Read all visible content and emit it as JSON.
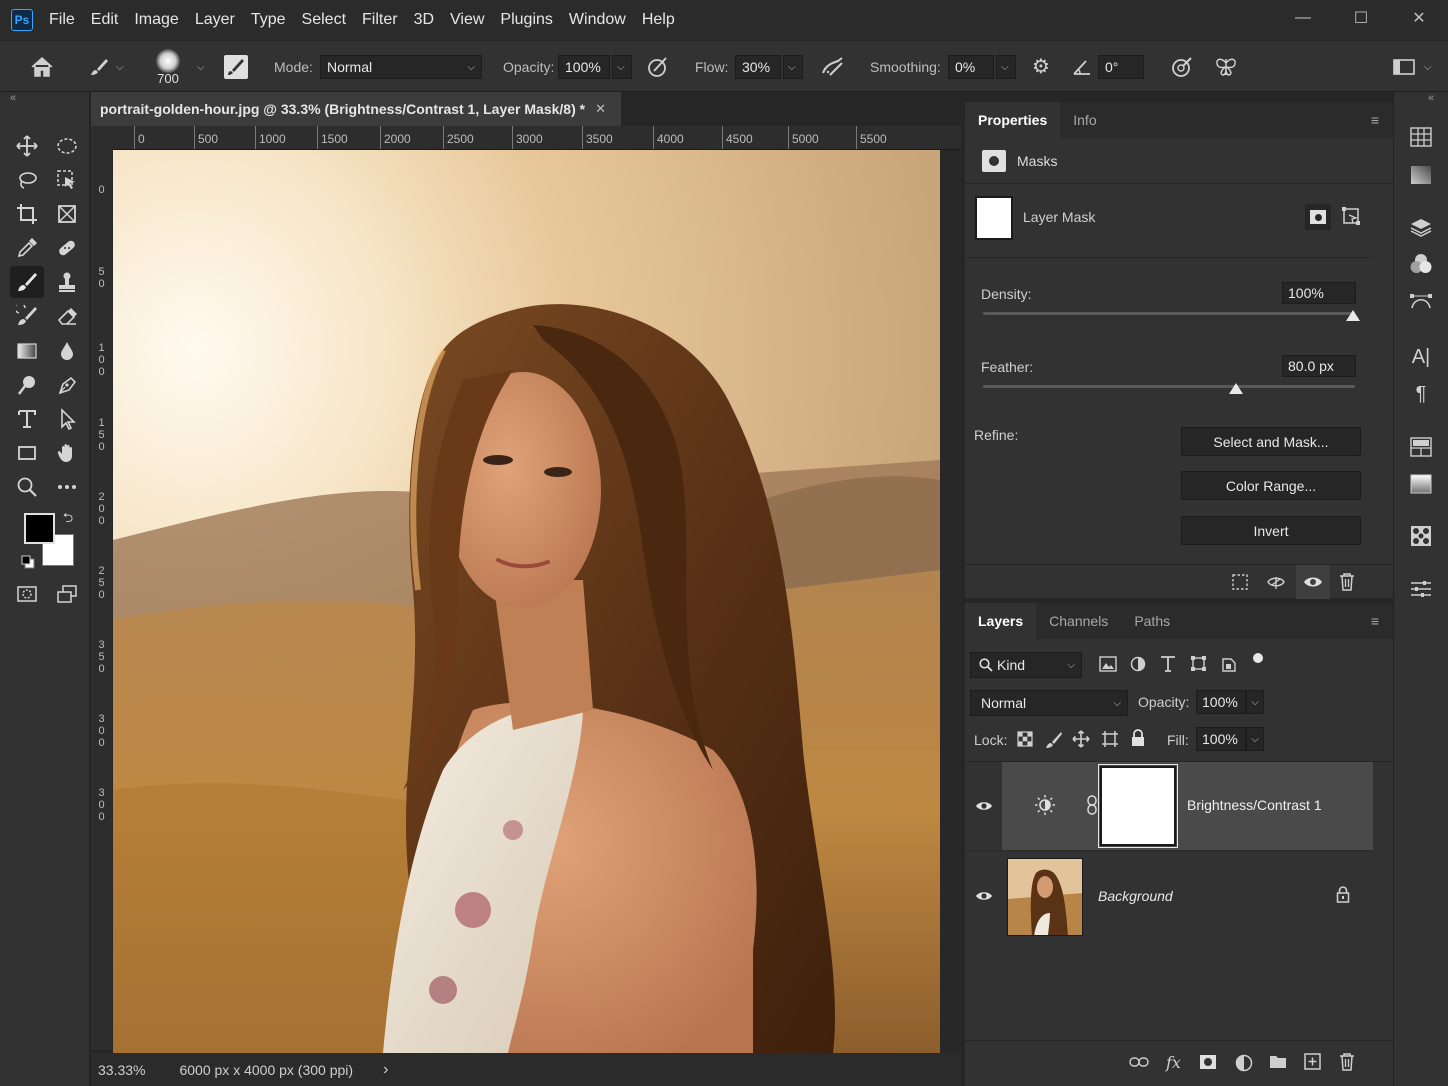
{
  "menu": [
    "File",
    "Edit",
    "Image",
    "Layer",
    "Type",
    "Select",
    "Filter",
    "3D",
    "View",
    "Plugins",
    "Window",
    "Help"
  ],
  "app_logo": "Ps",
  "window_controls": {
    "minimize": "—",
    "maximize": "☐",
    "close": "✕"
  },
  "options": {
    "brush_size": "700",
    "mode_label": "Mode:",
    "mode_value": "Normal",
    "opacity_label": "Opacity:",
    "opacity_value": "100%",
    "flow_label": "Flow:",
    "flow_value": "30%",
    "smoothing_label": "Smoothing:",
    "smoothing_value": "0%",
    "angle_value": "0°"
  },
  "document": {
    "tab_title": "portrait-golden-hour.jpg @ 33.3% (Brightness/Contrast 1, Layer Mask/8) *",
    "tab_close": "✕",
    "ruler_h": [
      "0",
      "500",
      "1000",
      "1500",
      "2000",
      "2500",
      "3000",
      "3500",
      "4000",
      "4500",
      "5000",
      "5500"
    ],
    "ruler_v": [
      "0",
      "5\n0",
      "1\n0\n0",
      "1\n5\n0",
      "2\n0\n0",
      "2\n5\n0",
      "3\n5\n0",
      "3\n0\n0",
      "3\n0\n0"
    ],
    "zoom": "33.33%",
    "dimensions": "6000 px x 4000 px (300 ppi)",
    "status_arrow": "›"
  },
  "properties": {
    "tabs": [
      "Properties",
      "Info"
    ],
    "section": "Masks",
    "mask_name": "Layer Mask",
    "density_label": "Density:",
    "density_value": "100%",
    "density_level": 1.0,
    "feather_label": "Feather:",
    "feather_value": "80.0 px",
    "feather_level": 0.68,
    "refine_label": "Refine:",
    "btn_select_mask": "Select and Mask...",
    "btn_color_range": "Color Range...",
    "btn_invert": "Invert"
  },
  "layers_panel": {
    "tabs": [
      "Layers",
      "Channels",
      "Paths"
    ],
    "kind_label": "Kind",
    "blend_mode": "Normal",
    "opacity_label": "Opacity:",
    "opacity_value": "100%",
    "lock_label": "Lock:",
    "fill_label": "Fill:",
    "fill_value": "100%",
    "layers": [
      {
        "name": "Brightness/Contrast 1",
        "visible": true,
        "selected": true
      },
      {
        "name": "Background",
        "visible": true,
        "selected": false
      }
    ]
  },
  "colors": {
    "accent": "#31a8ff",
    "panel": "#323232",
    "bg": "#262626"
  }
}
